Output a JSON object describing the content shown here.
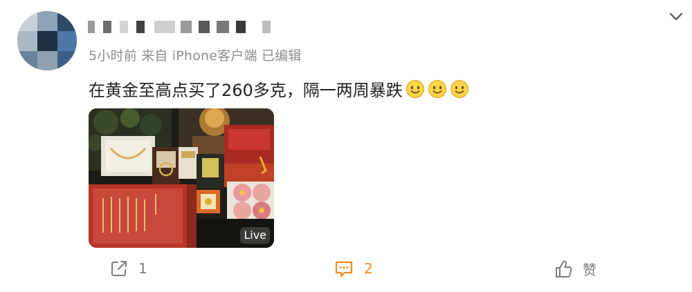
{
  "post": {
    "meta": "5小时前 来自 iPhone客户端 已编辑",
    "text": "在黄金至高点买了260多克，隔一两周暴跌",
    "emojis": [
      "smile-emoji",
      "smile-emoji",
      "smile-emoji"
    ],
    "image": {
      "badge": "Live",
      "description_icon": "photo"
    }
  },
  "actions": {
    "share_count": "1",
    "comment_count": "2",
    "like_label": "赞"
  },
  "colors": {
    "meta_text": "#8d8d8d",
    "body_text": "#222222",
    "comment_active": "#f28a1b",
    "action_gray": "#7b7b7b"
  },
  "icons": {
    "more": "chevron-down-icon",
    "share": "share-icon",
    "comment": "comment-icon",
    "like": "thumbs-up-icon"
  }
}
